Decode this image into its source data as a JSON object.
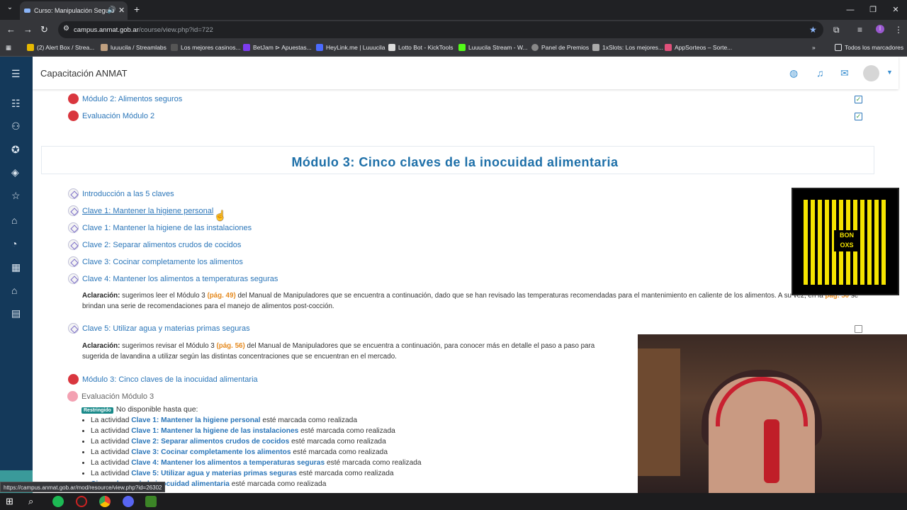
{
  "browser": {
    "tab_title": "Curso: Manipulación Seguro",
    "url_host": "campus.anmat.gob.ar",
    "url_path": "/course/view.php?id=722",
    "bookmarks": [
      "(2) Alert Box / Strea...",
      "luuucila / Streamlabs",
      "Los mejores casinos...",
      "BetJam ⊳ Apuestas...",
      "HeyLink.me | Luuucila",
      "Lotto Bot - KickTools",
      "Luuucila Stream - W...",
      "Panel de Premios",
      "1xSlots: Los mejores...",
      "AppSorteos – Sorte..."
    ],
    "all_bookmarks": "Todos los marcadores",
    "status_url": "https://campus.anmat.gob.ar/mod/resource/view.php?id=26302"
  },
  "site": {
    "title": "Capacitación ANMAT"
  },
  "module2": {
    "items": [
      "Módulo 2: Alimentos seguros",
      "Evaluación Módulo 2"
    ]
  },
  "module3": {
    "title": "Módulo 3: Cinco claves de la inocuidad alimentaria",
    "lessons": [
      "Introducción a las 5 claves",
      "Clave 1: Mantener la higiene personal",
      "Clave 1: Mantener la higiene de las instalaciones",
      "Clave 2: Separar alimentos crudos de cocidos",
      "Clave 3: Cocinar completamente los alimentos",
      "Clave 4: Mantener los alimentos a temperaturas seguras"
    ],
    "note1": {
      "label": "Aclaración:",
      "text_a": " sugerimos leer el Módulo 3 ",
      "page_ref": "(pág. 49)",
      "text_b": " del Manual de Manipuladores que se encuentra a continuación, dado que se han revisado las temperaturas recomendadas para el mantenimiento en caliente de los alimentos. A su vez, en la ",
      "page_ref2": "pág. 50",
      "text_c": " se brindan una serie de recomendaciones para el manejo de alimentos post-cocción."
    },
    "lesson5": "Clave 5: Utilizar agua y materias primas seguras",
    "note2": {
      "label": "Aclaración:",
      "text_a": " sugerimos revisar el Módulo 3 ",
      "page_ref": "(pág. 56)",
      "text_b": " del Manual de Manipuladores que se encuentra a continuación, para conocer más en detalle el paso a paso para",
      "text_c": "sugerida de lavandina a utilizar según las distintas concentraciones que se encuentran en el mercado."
    },
    "resource": "Módulo 3: Cinco claves de la inocuidad alimentaria",
    "evaluation": "Evaluación Módulo 3",
    "restricted_badge": "Restringido",
    "restricted_text": "No disponible hasta que:",
    "requirements": [
      {
        "pre": "La actividad ",
        "name": "Clave 1: Mantener la higiene personal",
        "post": " esté marcada como realizada"
      },
      {
        "pre": "La actividad ",
        "name": "Clave 1: Mantener la higiene de las instalaciones",
        "post": " esté marcada como realizada"
      },
      {
        "pre": "La actividad ",
        "name": "Clave 2: Separar alimentos crudos de cocidos",
        "post": " esté marcada como realizada"
      },
      {
        "pre": "La actividad ",
        "name": "Clave 3: Cocinar completamente los alimentos",
        "post": " esté marcada como realizada"
      },
      {
        "pre": "La actividad ",
        "name": "Clave 4: Mantener los alimentos a temperaturas seguras",
        "post": " esté marcada como realizada"
      },
      {
        "pre": "La actividad ",
        "name": "Clave 5: Utilizar agua y materias primas seguras",
        "post": " esté marcada como realizada"
      },
      {
        "pre": "",
        "name": "Cinco claves de la inocuidad alimentaria",
        "post": " esté marcada como realizada"
      }
    ]
  },
  "overlay": {
    "qr_label_1": "BON",
    "qr_label_2": "OXS"
  }
}
